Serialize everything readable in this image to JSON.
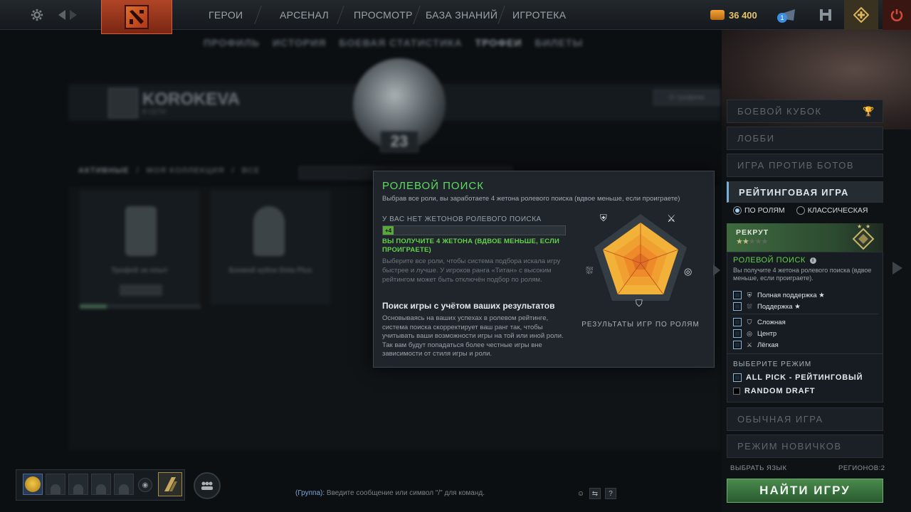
{
  "topbar": {
    "nav": [
      "ГЕРОИ",
      "АРСЕНАЛ",
      "ПРОСМОТР",
      "БАЗА ЗНАНИЙ",
      "ИГРОТЕКА"
    ],
    "gold": "36 400",
    "mail_count": "1",
    "icons": [
      "gear-icon",
      "back-icon",
      "forward-icon",
      "dota-logo",
      "mail-icon",
      "armory-icon",
      "plus-icon",
      "power-icon"
    ]
  },
  "background": {
    "subnav": [
      "ПРОФИЛЬ",
      "ИСТОРИЯ",
      "БОЕВАЯ СТАТИСТИКА",
      "ТРОФЕИ",
      "БИЛЕТЫ"
    ],
    "subnav_active": "ТРОФЕИ",
    "player_name": "KOROKEVA",
    "player_sub": "В СЕТИ",
    "level": "23",
    "trophy_button": "О трофеях",
    "tabs": [
      "АКТИВНЫЕ",
      "МОЯ КОЛЛЕКЦИЯ",
      "ВСЕ"
    ],
    "cards": [
      {
        "title": "Трофей за опыт"
      },
      {
        "title": "Боевой кубок Dota Plus"
      }
    ]
  },
  "popup": {
    "title": "РОЛЕВОЙ ПОИСК",
    "subtitle": "Выбрав все роли, вы заработаете 4 жетона ролевого поиска (вдвое меньше, если проиграете)",
    "token_label": "У ВАС НЕТ ЖЕТОНОВ РОЛЕВОГО ПОИСКА",
    "token_fraction": 0.06,
    "bar_text": "+4",
    "green_text": "ВЫ ПОЛУЧИТЕ 4 ЖЕТОНА (ВДВОЕ МЕНЬШЕ, ЕСЛИ ПРОИГРАЕТЕ)",
    "desc": "Выберите все роли, чтобы система подбора искала игру быстрее и лучше. У игроков ранга «Титан» с высоким рейтингом может быть отключён подбор по ролям.",
    "heading2": "Поиск игры с учётом ваших результатов",
    "desc2": "Основываясь на ваших успехах в ролевом рейтинге, система поиска скорректирует ваш ранг так, чтобы учитывать ваши возможности игры на той или иной роли. Так вам будут попадаться более честные игры вне зависимости от стиля игры и роли.",
    "chart_label": "РЕЗУЛЬТАТЫ ИГР ПО РОЛЯМ"
  },
  "right_panel": {
    "modes_top": [
      "БОЕВОЙ КУБОК",
      "ЛОББИ",
      "ИГРА ПРОТИВ БОТОВ"
    ],
    "active_mode": "РЕЙТИНГОВАЯ ИГРА",
    "radio_roles": "ПО РОЛЯМ",
    "radio_classic": "КЛАССИЧЕСКАЯ",
    "rank_title": "РЕКРУТ",
    "rank_stars": "★★",
    "rank_stars_dim": "★★★",
    "role_search_title": "РОЛЕВОЙ ПОИСК",
    "role_search_sub": "Вы получите 4 жетона ролевого поиска (вдвое меньше, если проиграете).",
    "roles": [
      {
        "label": "Полная поддержка ★",
        "icon": "hard-support-icon"
      },
      {
        "label": "Поддержка ★",
        "icon": "support-icon"
      },
      {
        "label": "Сложная",
        "icon": "offlane-icon"
      },
      {
        "label": "Центр",
        "icon": "mid-icon"
      },
      {
        "label": "Лёгкая",
        "icon": "carry-icon"
      }
    ],
    "mode_select_title": "ВЫБЕРИТЕ РЕЖИМ",
    "game_modes": [
      "ALL PICK - РЕЙТИНГОВЫЙ",
      "RANDOM DRAFT"
    ],
    "modes_bottom": [
      "ОБЫЧНАЯ ИГРА",
      "РЕЖИМ НОВИЧКОВ"
    ],
    "language": "ВЫБРАТЬ ЯЗЫК",
    "regions": "РЕГИОНОВ:2",
    "find_button": "НАЙТИ ИГРУ"
  },
  "bottom": {
    "chat_group": "(Группа):",
    "chat_placeholder": "Введите сообщение или символ \"/\" для команд."
  }
}
